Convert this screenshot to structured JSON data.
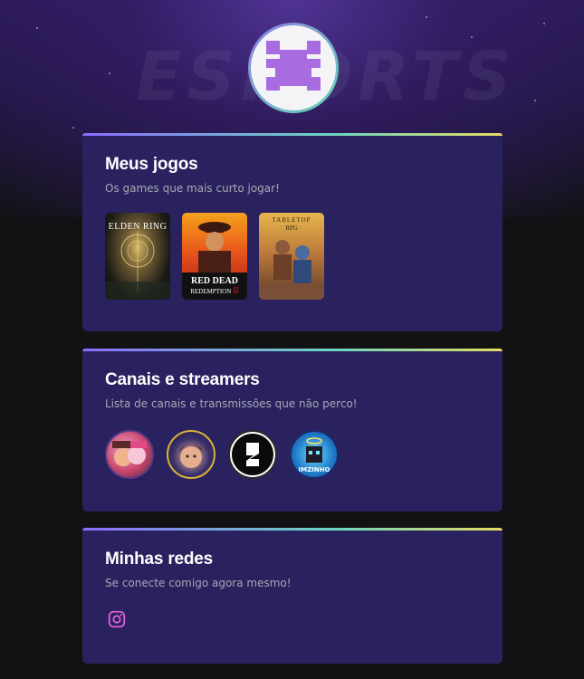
{
  "colors": {
    "page_bg": "#121214",
    "card_bg": "#29225f",
    "title": "#ffffff",
    "subtitle": "#a8a8b3",
    "accent_gradient": [
      "#8c6cff",
      "#6bd6c0",
      "#e5db62"
    ],
    "instagram": "#e05fd8"
  },
  "header": {
    "watermark_text": "ESPORTS",
    "avatar_icon": "pixel-logo-icon"
  },
  "games_section": {
    "title": "Meus jogos",
    "subtitle": "Os games que mais curto jogar!",
    "games": [
      {
        "name": "ELDEN RING",
        "icon": "elden-ring-cover"
      },
      {
        "name": "RED DEAD REDEMPTION II",
        "icon": "red-dead-redemption-2-cover"
      },
      {
        "name": "TABLETOP RPG",
        "icon": "tabletop-rpg-cover"
      }
    ]
  },
  "streamers_section": {
    "title": "Canais e streamers",
    "subtitle": "Lista de canais e transmissões que não perco!",
    "streamers": [
      {
        "icon": "streamer-avatar-duo"
      },
      {
        "icon": "streamer-avatar-boy"
      },
      {
        "icon": "streamer-avatar-logo"
      },
      {
        "icon": "streamer-avatar-imzinho",
        "label": "IMZINHO"
      }
    ]
  },
  "social_section": {
    "title": "Minhas redes",
    "subtitle": "Se conecte comigo agora mesmo!",
    "links": [
      {
        "icon": "instagram-icon"
      }
    ]
  }
}
